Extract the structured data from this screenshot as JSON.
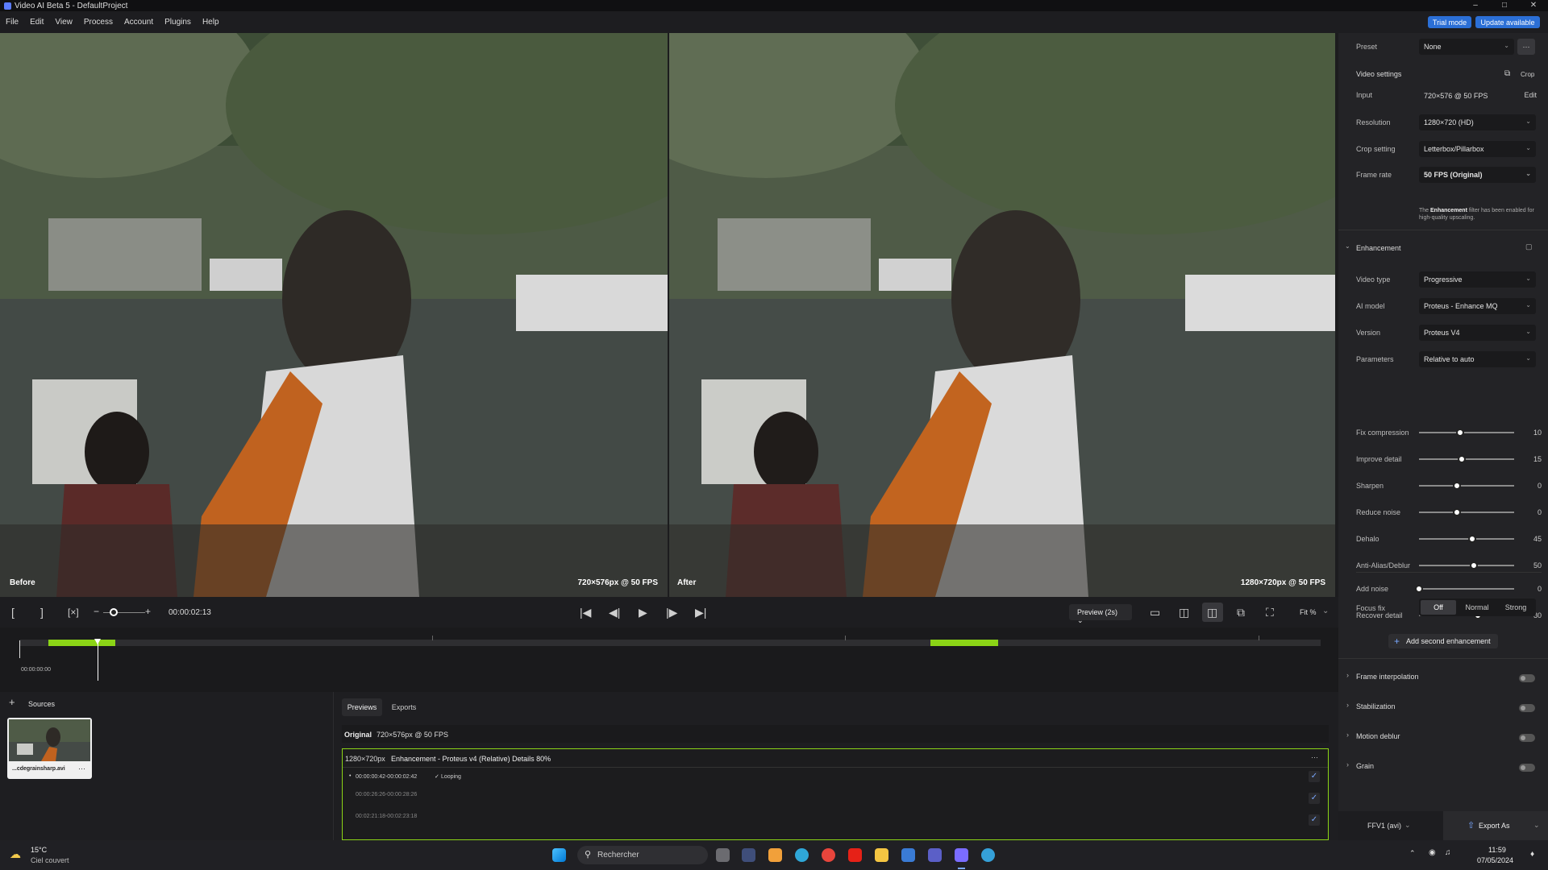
{
  "titlebar": {
    "title": "Video AI Beta 5 - DefaultProject"
  },
  "menu": [
    "File",
    "Edit",
    "View",
    "Process",
    "Account",
    "Plugins",
    "Help"
  ],
  "header": {
    "trial": "Trial mode",
    "update": "Update available"
  },
  "before": {
    "label": "Before",
    "res": "720×576px @ 50 FPS"
  },
  "after": {
    "label": "After",
    "res": "1280×720px @ 50 FPS"
  },
  "controls": {
    "time": "00:00:02:13",
    "preview": "Preview (2s)",
    "fit": "Fit %"
  },
  "timeline": {
    "start": "00:00:00:00",
    "playhead": 0.06,
    "segments": [
      {
        "start": 0.022,
        "end": 0.074
      },
      {
        "start": 0.7,
        "end": 0.752
      }
    ]
  },
  "sources": {
    "title": "Sources",
    "file": "...cdegrainsharp.avi",
    "more": "···"
  },
  "tabs": {
    "previews": "Previews",
    "exports": "Exports"
  },
  "original": {
    "label": "Original",
    "info": "720×576px @ 50 FPS"
  },
  "job": {
    "res": "1280×720px",
    "desc": "Enhancement - Proteus v4 (Relative) Details 80%",
    "more": "···",
    "items": [
      {
        "range": "00:00:00:42-00:00:02:42",
        "loop": "Looping"
      },
      {
        "range": "00:00:26:26-00:00:28:26"
      },
      {
        "range": "00:02:21:18-00:02:23:18"
      }
    ]
  },
  "panel": {
    "preset_label": "Preset",
    "preset_value": "None",
    "preset_more": "···",
    "video_settings": "Video settings",
    "crop": "Crop",
    "input_label": "Input",
    "input_value": "720×576 @ 50 FPS",
    "edit": "Edit",
    "resolution_label": "Resolution",
    "resolution_value": "1280×720 (HD)",
    "crop_setting_label": "Crop setting",
    "crop_setting_value": "Letterbox/Pillarbox",
    "frame_rate_label": "Frame rate",
    "frame_rate_value": "50 FPS (Original)",
    "note_pre": "The ",
    "note_bold": "Enhancement",
    "note_post": " filter has been enabled for high-quality upscaling.",
    "enhancement": "Enhancement",
    "video_type_label": "Video type",
    "video_type_value": "Progressive",
    "ai_model_label": "AI model",
    "ai_model_value": "Proteus - Enhance MQ",
    "version_label": "Version",
    "version_value": "Proteus V4",
    "parameters_label": "Parameters",
    "parameters_value": "Relative to auto",
    "sliders": [
      {
        "label": "Fix compression",
        "value": "10",
        "pos": 0.43
      },
      {
        "label": "Improve detail",
        "value": "15",
        "pos": 0.45
      },
      {
        "label": "Sharpen",
        "value": "0",
        "pos": 0.4
      },
      {
        "label": "Reduce noise",
        "value": "0",
        "pos": 0.4
      },
      {
        "label": "Dehalo",
        "value": "45",
        "pos": 0.56
      },
      {
        "label": "Anti-Alias/Deblur",
        "value": "50",
        "pos": 0.58
      }
    ],
    "sliders2": [
      {
        "label": "Add noise",
        "value": "0",
        "pos": 0.0
      },
      {
        "label": "Recover detail",
        "value": "80",
        "pos": 0.62
      }
    ],
    "focus_label": "Focus fix",
    "focus_off": "Off",
    "focus_normal": "Normal",
    "focus_strong": "Strong",
    "add_second": "Add second enhancement",
    "frame_interp": "Frame interpolation",
    "stabilization": "Stabilization",
    "motion_deblur": "Motion deblur",
    "grain": "Grain",
    "format": "FFV1 (avi)",
    "export": "Export As"
  },
  "taskbar": {
    "temp": "15°C",
    "weather": "Ciel couvert",
    "search": "Rechercher",
    "time": "11:59",
    "date": "07/05/2024"
  }
}
